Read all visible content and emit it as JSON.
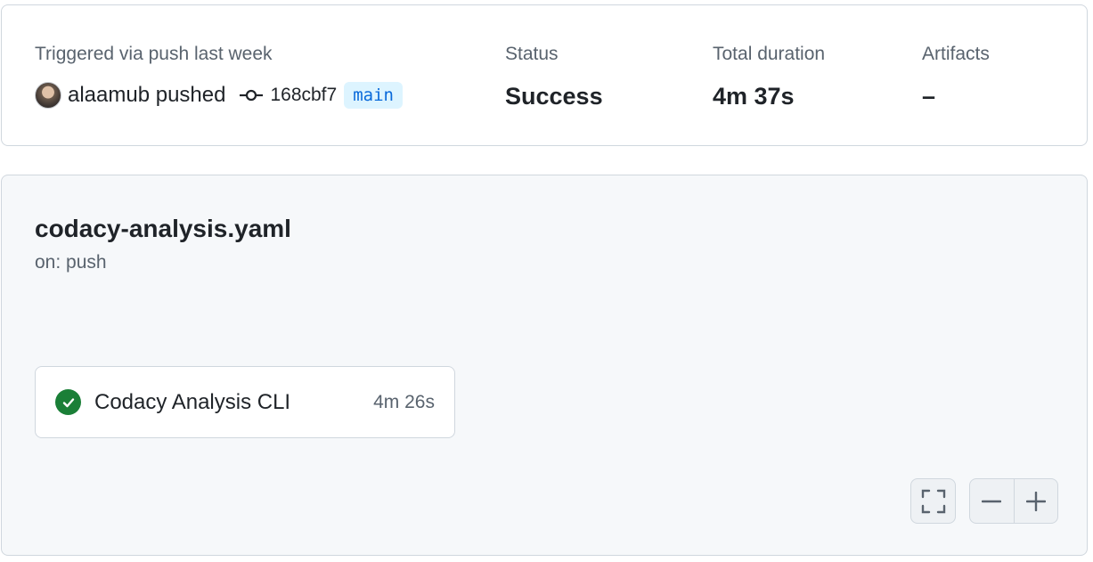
{
  "summary": {
    "trigger_label": "Triggered via push last week",
    "actor": "alaamub pushed",
    "commit_sha": "168cbf7",
    "branch": "main",
    "status_label": "Status",
    "status_value": "Success",
    "duration_label": "Total duration",
    "duration_value": "4m 37s",
    "artifacts_label": "Artifacts",
    "artifacts_value": "–"
  },
  "workflow": {
    "name": "codacy-analysis.yaml",
    "trigger": "on: push",
    "jobs": [
      {
        "name": "Codacy Analysis CLI",
        "duration": "4m 26s",
        "status": "success"
      }
    ]
  },
  "colors": {
    "success": "#1a7f37",
    "branch_text": "#0969da",
    "branch_bg": "#ddf4ff",
    "muted": "#59636e"
  },
  "icons": [
    "commit-icon",
    "check-circle-icon",
    "fullscreen-icon",
    "zoom-out-icon",
    "zoom-in-icon"
  ]
}
